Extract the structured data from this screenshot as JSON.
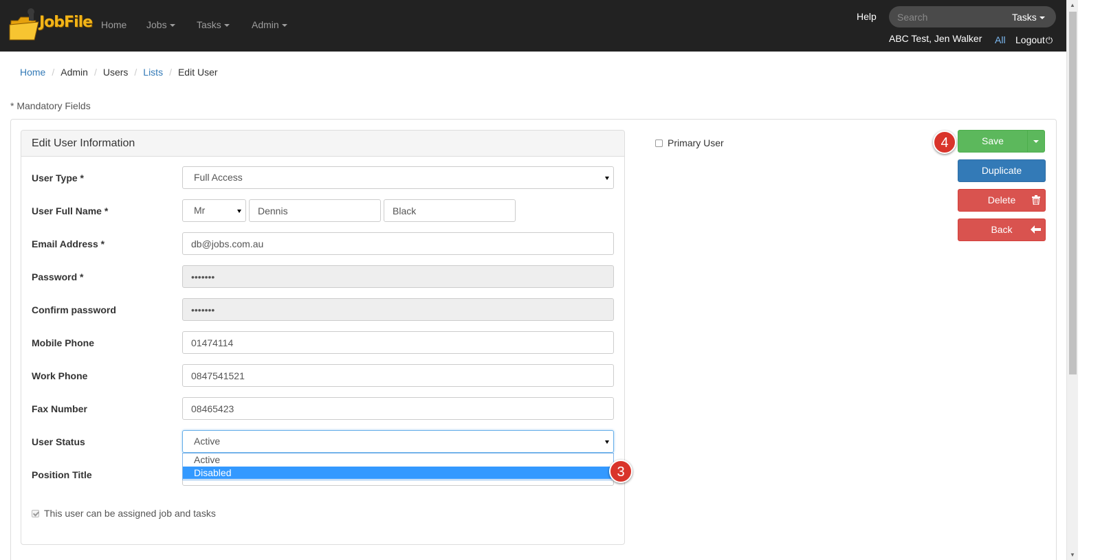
{
  "brand": {
    "logo_text": "JobFile"
  },
  "nav": {
    "items": [
      {
        "label": "Home",
        "dropdown": false
      },
      {
        "label": "Jobs",
        "dropdown": true
      },
      {
        "label": "Tasks",
        "dropdown": true
      },
      {
        "label": "Admin",
        "dropdown": true
      }
    ],
    "help": "Help",
    "search_placeholder": "Search",
    "search_scope": "Tasks",
    "user": "ABC Test, Jen Walker",
    "all": "All",
    "logout": "Logout"
  },
  "breadcrumb": [
    {
      "label": "Home",
      "link": true
    },
    {
      "label": "Admin",
      "link": false
    },
    {
      "label": "Users",
      "link": false
    },
    {
      "label": "Lists",
      "link": true
    },
    {
      "label": "Edit User",
      "link": false
    }
  ],
  "mandatory_note": "* Mandatory Fields",
  "panel_title": "Edit User Information",
  "form": {
    "user_type_label": "User Type *",
    "user_type_value": "Full Access",
    "full_name_label": "User Full Name *",
    "title_value": "Mr",
    "first_name": "Dennis",
    "last_name": "Black",
    "email_label": "Email Address *",
    "email_value": "db@jobs.com.au",
    "password_label": "Password *",
    "password_value": "•••••••",
    "confirm_label": "Confirm password",
    "confirm_value": "•••••••",
    "mobile_label": "Mobile Phone",
    "mobile_value": "01474114",
    "work_label": "Work Phone",
    "work_value": "0847541521",
    "fax_label": "Fax Number",
    "fax_value": "08465423",
    "status_label": "User Status",
    "status_value": "Active",
    "status_options": [
      "Active",
      "Disabled"
    ],
    "position_label": "Position Title",
    "assignable_label": "This user can be assigned job and tasks",
    "assignable_checked": true
  },
  "primary_user_label": "Primary User",
  "buttons": {
    "save": "Save",
    "duplicate": "Duplicate",
    "delete": "Delete",
    "back": "Back"
  },
  "step_badges": {
    "status_dropdown": "3",
    "save": "4"
  },
  "colors": {
    "navbar": "#222222",
    "link": "#337ab7",
    "save": "#5cb85c",
    "duplicate": "#337ab7",
    "danger": "#d9534f",
    "selected_option": "#3399ff",
    "badge": "#d9342b"
  }
}
